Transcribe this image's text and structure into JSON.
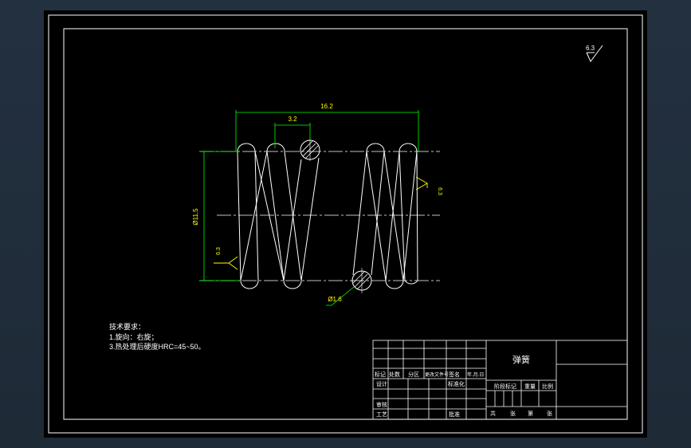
{
  "drawing": {
    "roughness_top_right": "6.3",
    "roughness_right": "6.3",
    "roughness_left": "6.3",
    "dim_total_length": "16.2",
    "dim_pitch": "3.2",
    "dim_outer_diameter": "Ø11.5",
    "dim_wire_diameter": "Ø1.6"
  },
  "notes": {
    "heading": "技术要求：",
    "line1": "1.旋向：右旋；",
    "line2": "3.热处理后硬度HRC=45~50。"
  },
  "title_block": {
    "part_name": "弹簧",
    "hdr_mark": "标记",
    "hdr_count": "处数",
    "hdr_zone": "分区",
    "hdr_doc": "更改文件号",
    "hdr_sign": "签名",
    "hdr_date": "年.月.日",
    "design": "设计",
    "standardize": "标准化",
    "review": "审核",
    "process": "工艺",
    "approve": "批准",
    "stage_mark": "阶段标记",
    "weight": "重量",
    "scale": "比例",
    "sheets_total": "共",
    "sheet_word1": "张",
    "sheet_no": "第",
    "sheet_word2": "张"
  },
  "colors": {
    "sheet": "#000000",
    "line": "#ffffff",
    "dimension": "#00ff00",
    "text": "#ffff00"
  }
}
